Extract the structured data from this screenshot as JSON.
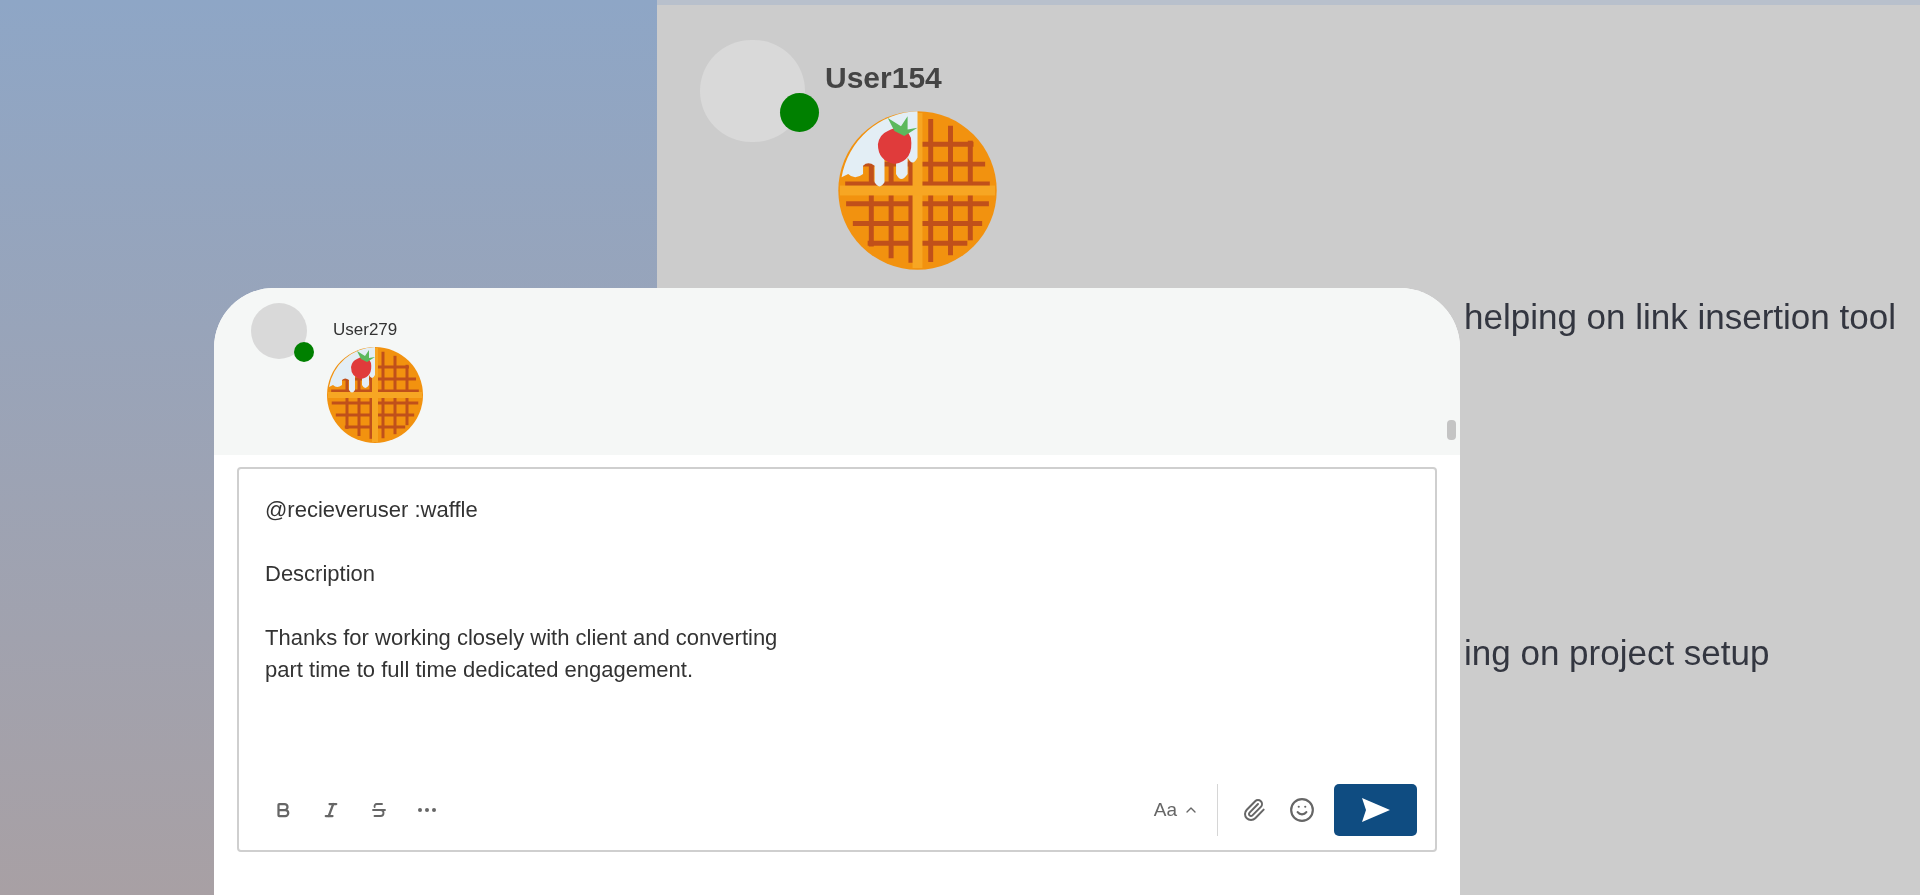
{
  "background_post": {
    "author": {
      "name": "User154",
      "online": true,
      "color": "#008000"
    },
    "lines": [
      "helping on link insertion tool",
      "ing on project setup"
    ]
  },
  "composer": {
    "author": {
      "name": "User279",
      "online": true,
      "color": "#008000"
    },
    "message_paragraphs": [
      [
        "@recieveruser :waffle"
      ],
      [
        "Description"
      ],
      [
        "Thanks for working closely with client and converting",
        "part time to full time dedicated engagement."
      ]
    ],
    "toolbar": {
      "font_size_label": "Aa",
      "send_disabled": false
    }
  }
}
